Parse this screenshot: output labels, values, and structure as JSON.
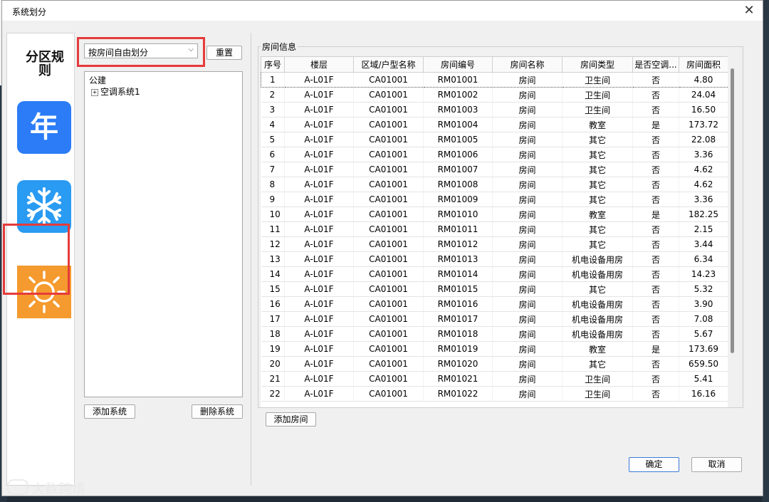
{
  "window": {
    "title": "系统划分",
    "close": "✕"
  },
  "sidebar": {
    "rule_label": "分区规则",
    "year_icon_text": "年",
    "active_item": "heating"
  },
  "left_panel": {
    "combo": {
      "value": "按房间自由划分",
      "arrow": "⌵"
    },
    "reset_label": "重置",
    "tree": {
      "root": "公建",
      "child": "空调系统1",
      "expander": "+"
    },
    "add_system_label": "添加系统",
    "delete_system_label": "删除系统"
  },
  "right_panel": {
    "group_title": "房间信息",
    "columns": [
      "序号",
      "楼层",
      "区域/户型名称",
      "房间编号",
      "房间名称",
      "房间类型",
      "是否空调...",
      "房间面积"
    ],
    "rows": [
      [
        "1",
        "A-L01F",
        "CA01001",
        "RM01001",
        "房间",
        "卫生间",
        "否",
        "4.80"
      ],
      [
        "2",
        "A-L01F",
        "CA01001",
        "RM01002",
        "房间",
        "卫生间",
        "否",
        "24.04"
      ],
      [
        "3",
        "A-L01F",
        "CA01001",
        "RM01003",
        "房间",
        "卫生间",
        "否",
        "16.50"
      ],
      [
        "4",
        "A-L01F",
        "CA01001",
        "RM01004",
        "房间",
        "教室",
        "是",
        "173.72"
      ],
      [
        "5",
        "A-L01F",
        "CA01001",
        "RM01005",
        "房间",
        "其它",
        "否",
        "22.08"
      ],
      [
        "6",
        "A-L01F",
        "CA01001",
        "RM01006",
        "房间",
        "其它",
        "否",
        "3.36"
      ],
      [
        "7",
        "A-L01F",
        "CA01001",
        "RM01007",
        "房间",
        "其它",
        "否",
        "4.62"
      ],
      [
        "8",
        "A-L01F",
        "CA01001",
        "RM01008",
        "房间",
        "其它",
        "否",
        "4.62"
      ],
      [
        "9",
        "A-L01F",
        "CA01001",
        "RM01009",
        "房间",
        "其它",
        "否",
        "3.36"
      ],
      [
        "10",
        "A-L01F",
        "CA01001",
        "RM01010",
        "房间",
        "教室",
        "是",
        "182.25"
      ],
      [
        "11",
        "A-L01F",
        "CA01001",
        "RM01011",
        "房间",
        "其它",
        "否",
        "2.15"
      ],
      [
        "12",
        "A-L01F",
        "CA01001",
        "RM01012",
        "房间",
        "其它",
        "否",
        "3.44"
      ],
      [
        "13",
        "A-L01F",
        "CA01001",
        "RM01013",
        "房间",
        "机电设备用房",
        "否",
        "6.34"
      ],
      [
        "14",
        "A-L01F",
        "CA01001",
        "RM01014",
        "房间",
        "机电设备用房",
        "否",
        "14.23"
      ],
      [
        "15",
        "A-L01F",
        "CA01001",
        "RM01015",
        "房间",
        "其它",
        "否",
        "5.32"
      ],
      [
        "16",
        "A-L01F",
        "CA01001",
        "RM01016",
        "房间",
        "机电设备用房",
        "否",
        "3.90"
      ],
      [
        "17",
        "A-L01F",
        "CA01001",
        "RM01017",
        "房间",
        "机电设备用房",
        "否",
        "7.08"
      ],
      [
        "18",
        "A-L01F",
        "CA01001",
        "RM01018",
        "房间",
        "机电设备用房",
        "否",
        "5.67"
      ],
      [
        "19",
        "A-L01F",
        "CA01001",
        "RM01019",
        "房间",
        "教室",
        "是",
        "173.69"
      ],
      [
        "20",
        "A-L01F",
        "CA01001",
        "RM01020",
        "房间",
        "其它",
        "否",
        "659.50"
      ],
      [
        "21",
        "A-L01F",
        "CA01001",
        "RM01021",
        "房间",
        "卫生间",
        "否",
        "5.41"
      ],
      [
        "22",
        "A-L01F",
        "CA01001",
        "RM01022",
        "房间",
        "卫生间",
        "否",
        "16.16"
      ]
    ],
    "add_room_label": "添加房间"
  },
  "footer": {
    "ok_label": "确定",
    "cancel_label": "取消"
  },
  "watermark": "大数跨境",
  "colors": {
    "year_icon": "#2b7cf6",
    "cool_icon": "#2a9bf2",
    "heat_icon": "#f59a2e",
    "highlight": "#e53b3b"
  }
}
